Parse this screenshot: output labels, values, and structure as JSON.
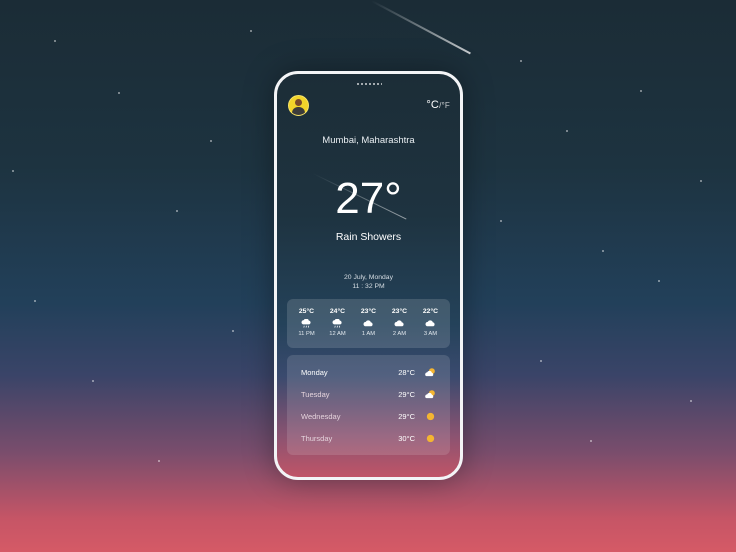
{
  "location": "Mumbai, Maharashtra",
  "unit_toggle": {
    "active": "°C",
    "alternate": "/°F"
  },
  "current": {
    "temperature": "27°",
    "condition": "Rain Showers",
    "date": "20 July, Monday",
    "time": "11 : 32 PM"
  },
  "hourly": [
    {
      "temp": "25°C",
      "time": "11 PM",
      "icon": "rain-cloud-icon"
    },
    {
      "temp": "24°C",
      "time": "12 AM",
      "icon": "rain-cloud-icon"
    },
    {
      "temp": "23°C",
      "time": "1 AM",
      "icon": "cloud-icon"
    },
    {
      "temp": "23°C",
      "time": "2 AM",
      "icon": "cloud-icon"
    },
    {
      "temp": "22°C",
      "time": "3 AM",
      "icon": "cloud-icon"
    }
  ],
  "daily": [
    {
      "day": "Monday",
      "temp": "28°C",
      "icon": "partly-cloudy-icon",
      "highlight": true
    },
    {
      "day": "Tuesday",
      "temp": "29°C",
      "icon": "partly-cloudy-icon",
      "highlight": false
    },
    {
      "day": "Wednesday",
      "temp": "29°C",
      "icon": "sun-icon",
      "highlight": false
    },
    {
      "day": "Thursday",
      "temp": "30°C",
      "icon": "sun-icon",
      "highlight": false
    }
  ],
  "colors": {
    "sun": "#f4b531",
    "highlight_text": "#ffffff",
    "muted_text": "#e4d3dc"
  }
}
